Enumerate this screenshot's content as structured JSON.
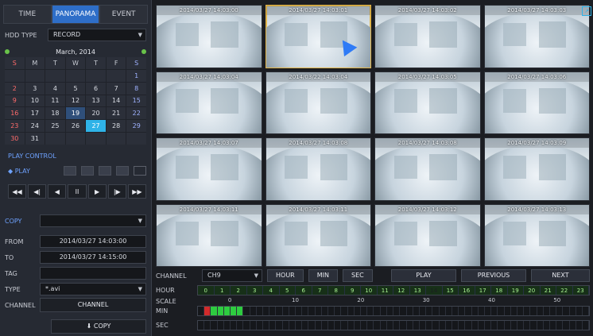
{
  "tabs": {
    "items": [
      {
        "label": "TIME",
        "active": false
      },
      {
        "label": "PANORAMA",
        "active": true
      },
      {
        "label": "EVENT",
        "active": false
      }
    ]
  },
  "hdd": {
    "label": "HDD TYPE",
    "value": "RECORD"
  },
  "calendar": {
    "month_label": "March, 2014",
    "dow": [
      "S",
      "M",
      "T",
      "W",
      "T",
      "F",
      "S"
    ],
    "weeks": [
      [
        "",
        "",
        "",
        "",
        "",
        "",
        "1"
      ],
      [
        "2",
        "3",
        "4",
        "5",
        "6",
        "7",
        "8"
      ],
      [
        "9",
        "10",
        "11",
        "12",
        "13",
        "14",
        "15"
      ],
      [
        "16",
        "17",
        "18",
        "19",
        "20",
        "21",
        "22"
      ],
      [
        "23",
        "24",
        "25",
        "26",
        "27",
        "28",
        "29"
      ],
      [
        "30",
        "31",
        "",
        "",
        "",
        "",
        ""
      ]
    ],
    "highlighted_day": "19",
    "selected_day": "27"
  },
  "play_control": {
    "title": "PLAY CONTROL",
    "play_label": "PLAY",
    "buttons": [
      "◀◀",
      "◀|",
      "◀",
      "II",
      "▶",
      "|▶",
      "▶▶"
    ]
  },
  "copy": {
    "title": "COPY",
    "from_label": "FROM",
    "from_value": "2014/03/27 14:03:00",
    "to_label": "TO",
    "to_value": "2014/03/27 14:15:00",
    "tag_label": "TAG",
    "tag_value": "",
    "type_label": "TYPE",
    "type_value": "*.avi",
    "channel_label": "CHANNEL",
    "channel_button": "CHANNEL",
    "copy_button": "COPY"
  },
  "thumbnails": {
    "timestamps": [
      "2014/03/27 14:03:00",
      "2014/03/27 14:03:01",
      "2014/03/27 14:03:02",
      "2014/03/27 14:03:03",
      "2014/03/27 14:03:04",
      "2014/03/22 14:03:04",
      "2014/03/27 14:03:05",
      "2014/03/27 14:03:06",
      "2014/03/27 14:03:07",
      "2014/03/27 14:03:08",
      "2014/03/27 14:03:08",
      "2014/03/27 14:03:09",
      "2014/03/27 14:03:11",
      "2014/03/27 14:03:11",
      "2014/03/27 14:03:12",
      "2014/03/27 14:03:13"
    ],
    "active_index": 1
  },
  "controls": {
    "channel_label": "CHANNEL",
    "channel_value": "CH9",
    "hour": "HOUR",
    "min": "MIN",
    "sec": "SEC",
    "play": "PLAY",
    "previous": "PREVIOUS",
    "next": "NEXT"
  },
  "timeline": {
    "hour_label": "HOUR",
    "hours": [
      "0",
      "1",
      "2",
      "3",
      "4",
      "5",
      "6",
      "7",
      "8",
      "9",
      "10",
      "11",
      "12",
      "13",
      "14",
      "15",
      "16",
      "17",
      "18",
      "19",
      "20",
      "21",
      "22",
      "23"
    ],
    "hour_highlight": "14",
    "scale_label": "SCALE",
    "scale_ticks": [
      "0",
      "10",
      "20",
      "30",
      "40",
      "50"
    ],
    "min_label": "MIN",
    "sec_label": "SEC"
  },
  "colors": {
    "accent": "#2e6ec8",
    "calendar_selected": "#2fb3e8",
    "hour_highlight": "#e7d13a",
    "timeline_red": "#d12b2b",
    "timeline_green": "#2ecc40"
  }
}
